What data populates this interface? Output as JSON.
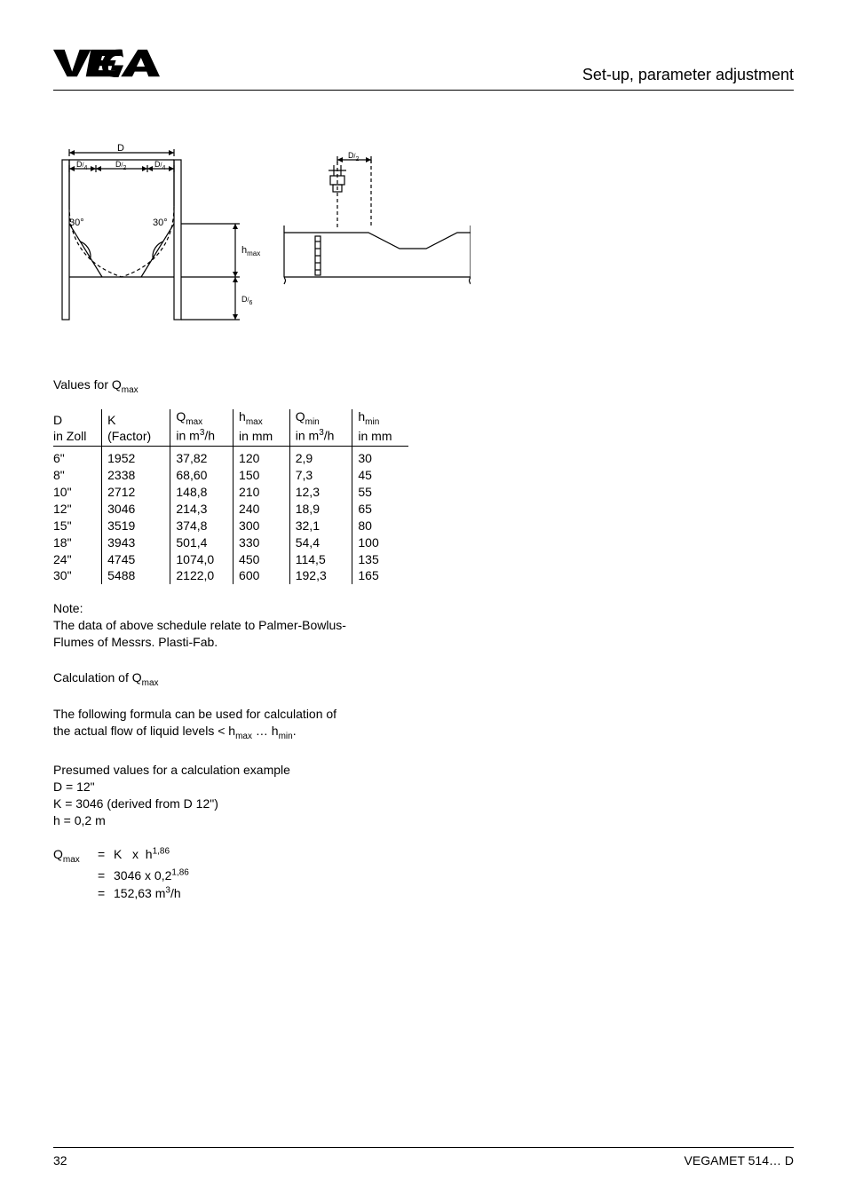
{
  "header": {
    "logo": "VEGA",
    "title": "Set-up, parameter adjustment"
  },
  "section": {
    "values_title": "Values for Q",
    "values_title_sub": "max"
  },
  "table": {
    "headers": {
      "c0a": "D",
      "c0b": "in Zoll",
      "c1a": "K",
      "c1b": "(Factor)",
      "c2a": "Q",
      "c2a_sub": "max",
      "c2b": "in m",
      "c2b_sup": "3",
      "c2b_tail": "/h",
      "c3a": "h",
      "c3a_sub": "max",
      "c3b": "in mm",
      "c4a": "Q",
      "c4a_sub": "min",
      "c4b": "in m",
      "c4b_sup": "3",
      "c4b_tail": "/h",
      "c5a": "h",
      "c5a_sub": "min",
      "c5b": "in mm"
    },
    "rows": [
      {
        "d": "6\"",
        "k": "1952",
        "qmax": "37,82",
        "hmax": "120",
        "qmin": "2,9",
        "hmin": "30"
      },
      {
        "d": "8\"",
        "k": "2338",
        "qmax": "68,60",
        "hmax": "150",
        "qmin": "7,3",
        "hmin": "45"
      },
      {
        "d": "10\"",
        "k": "2712",
        "qmax": "148,8",
        "hmax": "210",
        "qmin": "12,3",
        "hmin": "55"
      },
      {
        "d": "12\"",
        "k": "3046",
        "qmax": "214,3",
        "hmax": "240",
        "qmin": "18,9",
        "hmin": "65"
      },
      {
        "d": "15\"",
        "k": "3519",
        "qmax": "374,8",
        "hmax": "300",
        "qmin": "32,1",
        "hmin": "80"
      },
      {
        "d": "18\"",
        "k": "3943",
        "qmax": "501,4",
        "hmax": "330",
        "qmin": "54,4",
        "hmin": "100"
      },
      {
        "d": "24\"",
        "k": "4745",
        "qmax": "1074,0",
        "hmax": "450",
        "qmin": "114,5",
        "hmin": "135"
      },
      {
        "d": "30\"",
        "k": "5488",
        "qmax": "2122,0",
        "hmax": "600",
        "qmin": "192,3",
        "hmin": "165"
      }
    ]
  },
  "note": {
    "label": "Note:",
    "line1": "The data of above schedule relate to Palmer-Bowlus-",
    "line2": "Flumes of Messrs. Plasti-Fab."
  },
  "calc": {
    "title_pre": "Calculation of Q",
    "title_sub": "max",
    "text1": "The following formula can be used for calculation of",
    "text2_pre": "the actual flow of liquid levels < h",
    "text2_sub1": "max",
    "text2_mid": " … h",
    "text2_sub2": "min",
    "text2_end": "."
  },
  "presumed": {
    "line0": "Presumed values for a calculation example",
    "line1": "D = 12\"",
    "line2": "K = 3046 (derived from D 12\")",
    "line3": "h = 0,2 m"
  },
  "equation": {
    "lhs": "Q",
    "lhs_sub": "max",
    "row1_rhs_pre": "K   x  h",
    "row1_rhs_sup": "1,86",
    "row2_rhs_pre": "3046 x 0,2",
    "row2_rhs_sup": "1,86",
    "row3_rhs_pre": "152,63 m",
    "row3_rhs_sup": "3",
    "row3_rhs_tail": "/h"
  },
  "footer": {
    "page": "32",
    "doc": "VEGAMET 514… D"
  },
  "diagram_labels": {
    "D": "D",
    "D4": "D",
    "D2": "D",
    "frac4": "4",
    "frac2": "2",
    "frac6": "6",
    "thirty_a": "30°",
    "thirty_b": "30°",
    "hmax": "h",
    "hmax_sub": "max"
  }
}
